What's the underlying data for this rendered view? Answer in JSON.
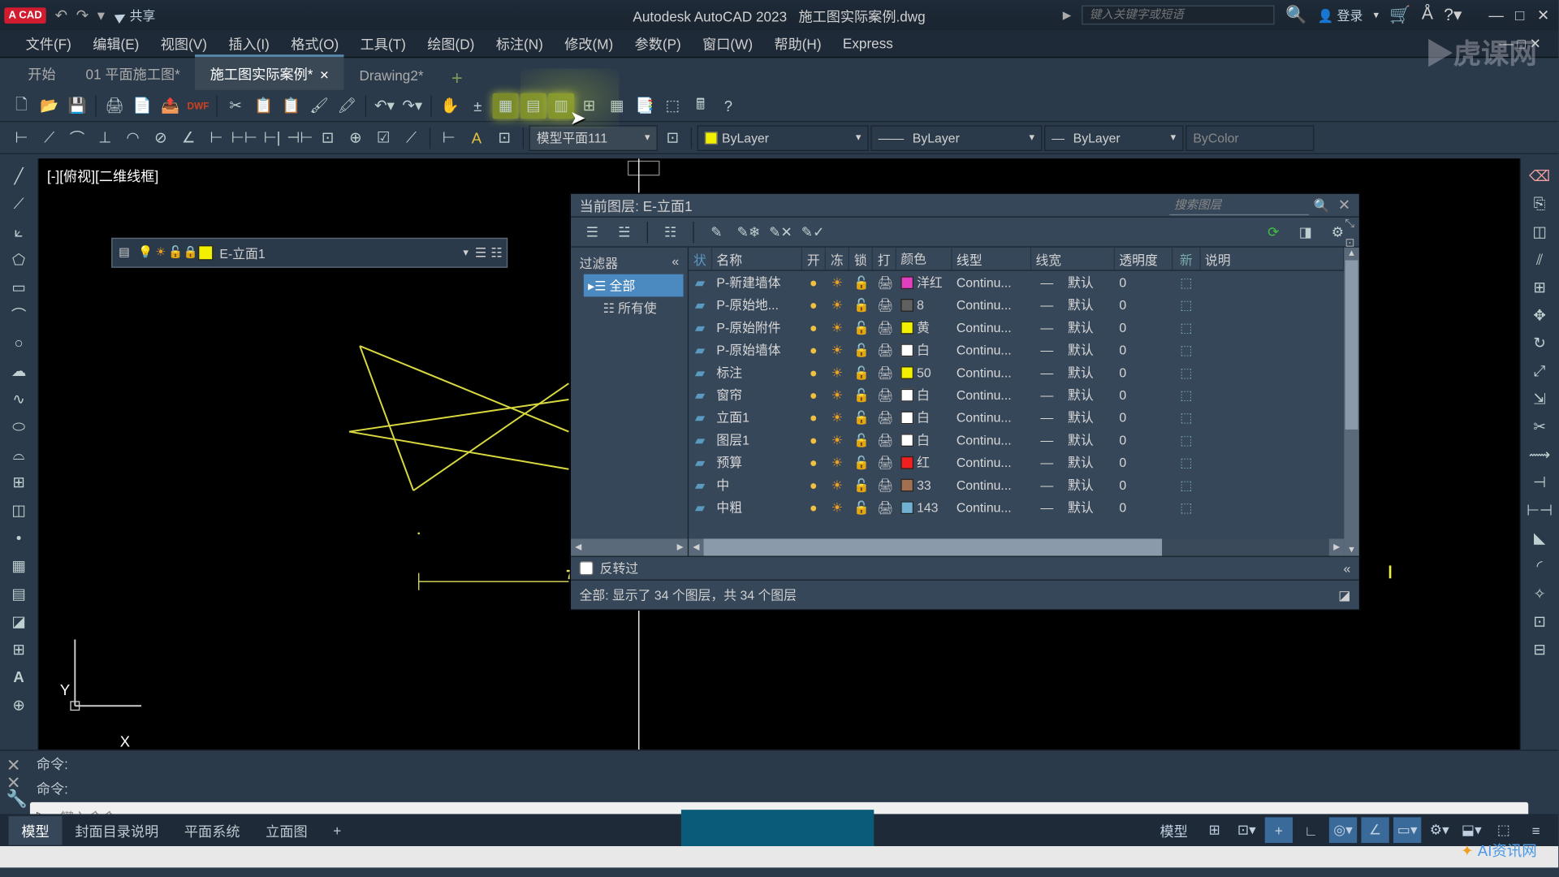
{
  "title_bar": {
    "logo": "A CAD",
    "share": "共享",
    "app_name": "Autodesk AutoCAD 2023",
    "doc_name": "施工图实际案例.dwg",
    "search_placeholder": "键入关键字或短语",
    "login": "登录"
  },
  "menu": {
    "items": [
      "文件(F)",
      "编辑(E)",
      "视图(V)",
      "插入(I)",
      "格式(O)",
      "工具(T)",
      "绘图(D)",
      "标注(N)",
      "修改(M)",
      "参数(P)",
      "窗口(W)",
      "帮助(H)",
      "Express"
    ]
  },
  "doc_tabs": {
    "tabs": [
      {
        "label": "开始",
        "active": false,
        "close": false
      },
      {
        "label": "01 平面施工图*",
        "active": false,
        "close": false
      },
      {
        "label": "施工图实际案例*",
        "active": true,
        "close": true
      },
      {
        "label": "Drawing2*",
        "active": false,
        "close": false
      }
    ]
  },
  "properties": {
    "layer_style": "模型平面111",
    "color": "ByLayer",
    "linetype": "ByLayer",
    "lineweight": "ByLayer",
    "plotstyle": "ByColor"
  },
  "canvas": {
    "view_label": "[-][俯视][二维线框]",
    "ucs_y": "Y",
    "ucs_x": "X"
  },
  "layer_dropdown": {
    "current": "E-立面1"
  },
  "layer_palette": {
    "title": "当前图层: E-立面1",
    "search_placeholder": "搜索图层",
    "tree_header": "过滤器",
    "tree_all": "全部",
    "tree_used": "所有使",
    "columns": {
      "status": "状",
      "name": "名称",
      "on": "开",
      "freeze": "冻",
      "lock": "锁",
      "plot": "打",
      "color": "颜色",
      "ltype": "线型",
      "lw": "线宽",
      "trans": "透明度",
      "new": "新",
      "desc": "说明"
    },
    "rows": [
      {
        "name": "P-新建墙体",
        "swatch": "#e040c0",
        "cname": "洋红",
        "ltype": "Continu...",
        "lw": "—",
        "lwtxt": "默认",
        "trans": "0"
      },
      {
        "name": "P-原始地...",
        "swatch": "#606060",
        "cname": "8",
        "ltype": "Continu...",
        "lw": "—",
        "lwtxt": "默认",
        "trans": "0"
      },
      {
        "name": "P-原始附件",
        "swatch": "#f0f000",
        "cname": "黄",
        "ltype": "Continu...",
        "lw": "—",
        "lwtxt": "默认",
        "trans": "0"
      },
      {
        "name": "P-原始墙体",
        "swatch": "#ffffff",
        "cname": "白",
        "ltype": "Continu...",
        "lw": "—",
        "lwtxt": "默认",
        "trans": "0"
      },
      {
        "name": "标注",
        "swatch": "#f0f000",
        "cname": "50",
        "ltype": "Continu...",
        "lw": "—",
        "lwtxt": "默认",
        "trans": "0"
      },
      {
        "name": "窗帘",
        "swatch": "#ffffff",
        "cname": "白",
        "ltype": "Continu...",
        "lw": "—",
        "lwtxt": "默认",
        "trans": "0"
      },
      {
        "name": "立面1",
        "swatch": "#ffffff",
        "cname": "白",
        "ltype": "Continu...",
        "lw": "—",
        "lwtxt": "默认",
        "trans": "0"
      },
      {
        "name": "图层1",
        "swatch": "#ffffff",
        "cname": "白",
        "ltype": "Continu...",
        "lw": "—",
        "lwtxt": "默认",
        "trans": "0"
      },
      {
        "name": "预算",
        "swatch": "#f02020",
        "cname": "红",
        "ltype": "Continu...",
        "lw": "—",
        "lwtxt": "默认",
        "trans": "0"
      },
      {
        "name": "中",
        "swatch": "#a07050",
        "cname": "33",
        "ltype": "Continu...",
        "lw": "—",
        "lwtxt": "默认",
        "trans": "0"
      },
      {
        "name": "中粗",
        "swatch": "#70b0d0",
        "cname": "143",
        "ltype": "Continu...",
        "lw": "—",
        "lwtxt": "默认",
        "trans": "0"
      }
    ],
    "invert": "反转过",
    "status": "全部: 显示了 34 个图层，共 34 个图层"
  },
  "command": {
    "hist1": "命令:",
    "hist2": "命令:",
    "placeholder": "键入命令"
  },
  "layout_tabs": {
    "tabs": [
      "模型",
      "封面目录说明",
      "平面系统",
      "立面图"
    ],
    "active": 0,
    "model_btn": "模型"
  },
  "watermark1": "▶虎课网",
  "watermark2": "AI资讯网"
}
